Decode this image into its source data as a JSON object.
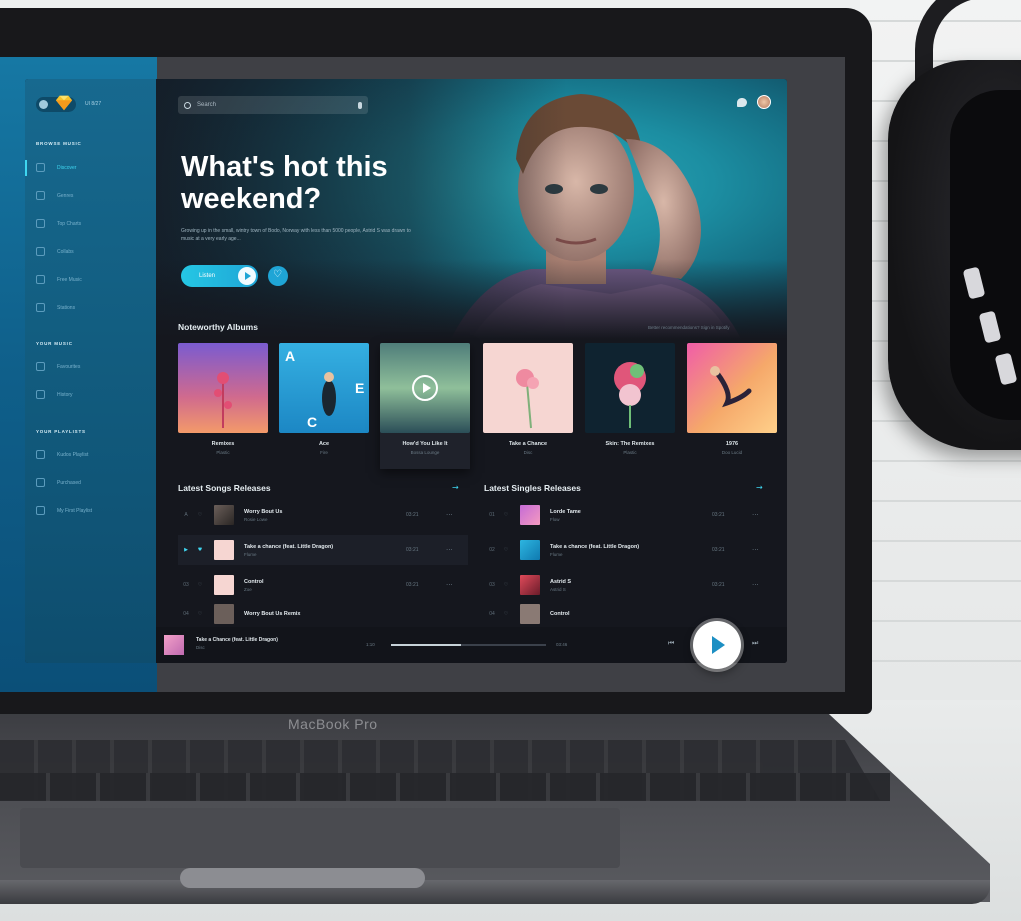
{
  "device": {
    "label": "MacBook Pro"
  },
  "sidebar": {
    "user": "UI 8/27",
    "browse_heading": "BROWSE MUSIC",
    "browse_items": [
      {
        "label": "Discover",
        "icon": "compass-icon",
        "active": true
      },
      {
        "label": "Genres",
        "icon": "grid-icon"
      },
      {
        "label": "Top Charts",
        "icon": "chart-icon"
      },
      {
        "label": "Collabs",
        "icon": "users-icon"
      },
      {
        "label": "Free Music",
        "icon": "headphones-icon"
      },
      {
        "label": "Stations",
        "icon": "radio-icon"
      }
    ],
    "your_music_heading": "YOUR MUSIC",
    "your_music_items": [
      {
        "label": "Favourites",
        "icon": "heart-icon"
      },
      {
        "label": "History",
        "icon": "clock-icon"
      }
    ],
    "playlists_heading": "YOUR PLAYLISTS",
    "playlist_items": [
      {
        "label": "Kudos Playlist",
        "icon": "playlist-icon"
      },
      {
        "label": "Purchased",
        "icon": "note-icon"
      },
      {
        "label": "My First Playlist",
        "icon": "playlist-icon"
      }
    ]
  },
  "search": {
    "placeholder": "Search"
  },
  "hero": {
    "title": "What's hot this weekend?",
    "description": "Growing up in the small, wintry town of Bodo, Norway with less than 5000 people, Astrid S was drawn to music at a very early age...",
    "listen_label": "Listen"
  },
  "albums_section": {
    "title": "Noteworthy Albums",
    "link": "Better recommendations? Sign in Spotify",
    "albums": [
      {
        "title": "Remixes",
        "artist": "Plastic"
      },
      {
        "title": "Ace",
        "artist": "Fire"
      },
      {
        "title": "How'd You Like It",
        "artist": "Bossa Lounge"
      },
      {
        "title": "Take a Chance",
        "artist": "Disc"
      },
      {
        "title": "Skin: The Remixes",
        "artist": "Plastic"
      },
      {
        "title": "1976",
        "artist": "Doo Lucid"
      }
    ]
  },
  "songs_section": {
    "title": "Latest Songs Releases",
    "rows": [
      {
        "num": "A",
        "title": "Worry Bout Us",
        "artist": "Rosie Lowe",
        "duration": "03:21"
      },
      {
        "num": "▶",
        "title": "Take a chance (feat. Little Dragon)",
        "artist": "Flume",
        "duration": "03:21"
      },
      {
        "num": "03",
        "title": "Control",
        "artist": "Zoe",
        "duration": "03:21"
      },
      {
        "num": "04",
        "title": "Worry Bout Us Remix",
        "artist": "",
        "duration": ""
      }
    ]
  },
  "singles_section": {
    "title": "Latest Singles Releases",
    "rows": [
      {
        "num": "01",
        "title": "Lorde Tame",
        "artist": "Flow",
        "duration": "03:21"
      },
      {
        "num": "02",
        "title": "Take a chance (feat. Little Dragon)",
        "artist": "Flume",
        "duration": "03:21"
      },
      {
        "num": "03",
        "title": "Astrid S",
        "artist": "Astrid S",
        "duration": "03:21"
      },
      {
        "num": "04",
        "title": "Control",
        "artist": "",
        "duration": ""
      }
    ]
  },
  "player": {
    "title": "Take a Chance (feat. Little Dragon)",
    "artist": "Disc",
    "elapsed": "1:10",
    "total": "03:46",
    "progress": 0.45
  },
  "colors": {
    "accent": "#3fd6f0",
    "sidebar": "#17698f"
  }
}
